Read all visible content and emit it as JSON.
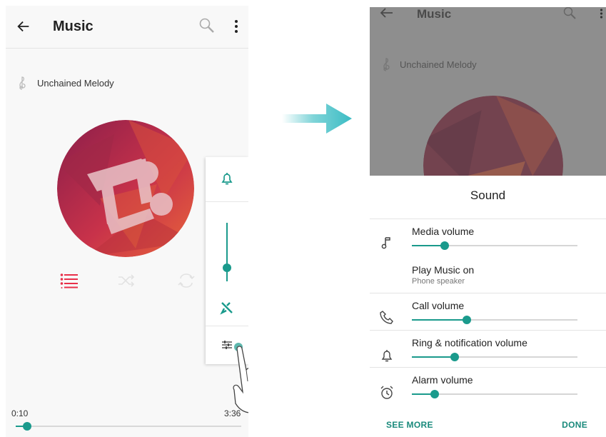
{
  "colors": {
    "accent": "#1a9a8c",
    "red_accent": "#e8304a",
    "arrow": "#3bbcc4"
  },
  "left_screen": {
    "app_title": "Music",
    "song_title": "Unchained Melody",
    "time_elapsed": "0:10",
    "time_total": "3:36",
    "seek_fraction": 0.05,
    "volume_fraction": 0.3,
    "icons": {
      "back": "back-arrow-icon",
      "search": "search-icon",
      "more": "more-vert-icon",
      "song": "treble-clef-icon",
      "playlist": "playlist-icon",
      "shuffle": "shuffle-icon",
      "repeat": "repeat-icon",
      "ring": "bell-icon",
      "mute": "vibrate-off-icon",
      "settings": "equalizer-icon"
    }
  },
  "right_screen": {
    "app_title": "Music",
    "song_title": "Unchained Melody",
    "sheet_title": "Sound",
    "rows": [
      {
        "label": "Media volume",
        "icon": "music-note-icon",
        "level": 0.2
      },
      {
        "label": "Play Music on",
        "sub": "Phone speaker"
      },
      {
        "label": "Call volume",
        "icon": "phone-icon",
        "level": 0.33
      },
      {
        "label": "Ring & notification volume",
        "icon": "bell-icon",
        "level": 0.26
      },
      {
        "label": "Alarm volume",
        "icon": "alarm-icon",
        "level": 0.14
      }
    ],
    "see_more": "SEE MORE",
    "done": "DONE"
  }
}
